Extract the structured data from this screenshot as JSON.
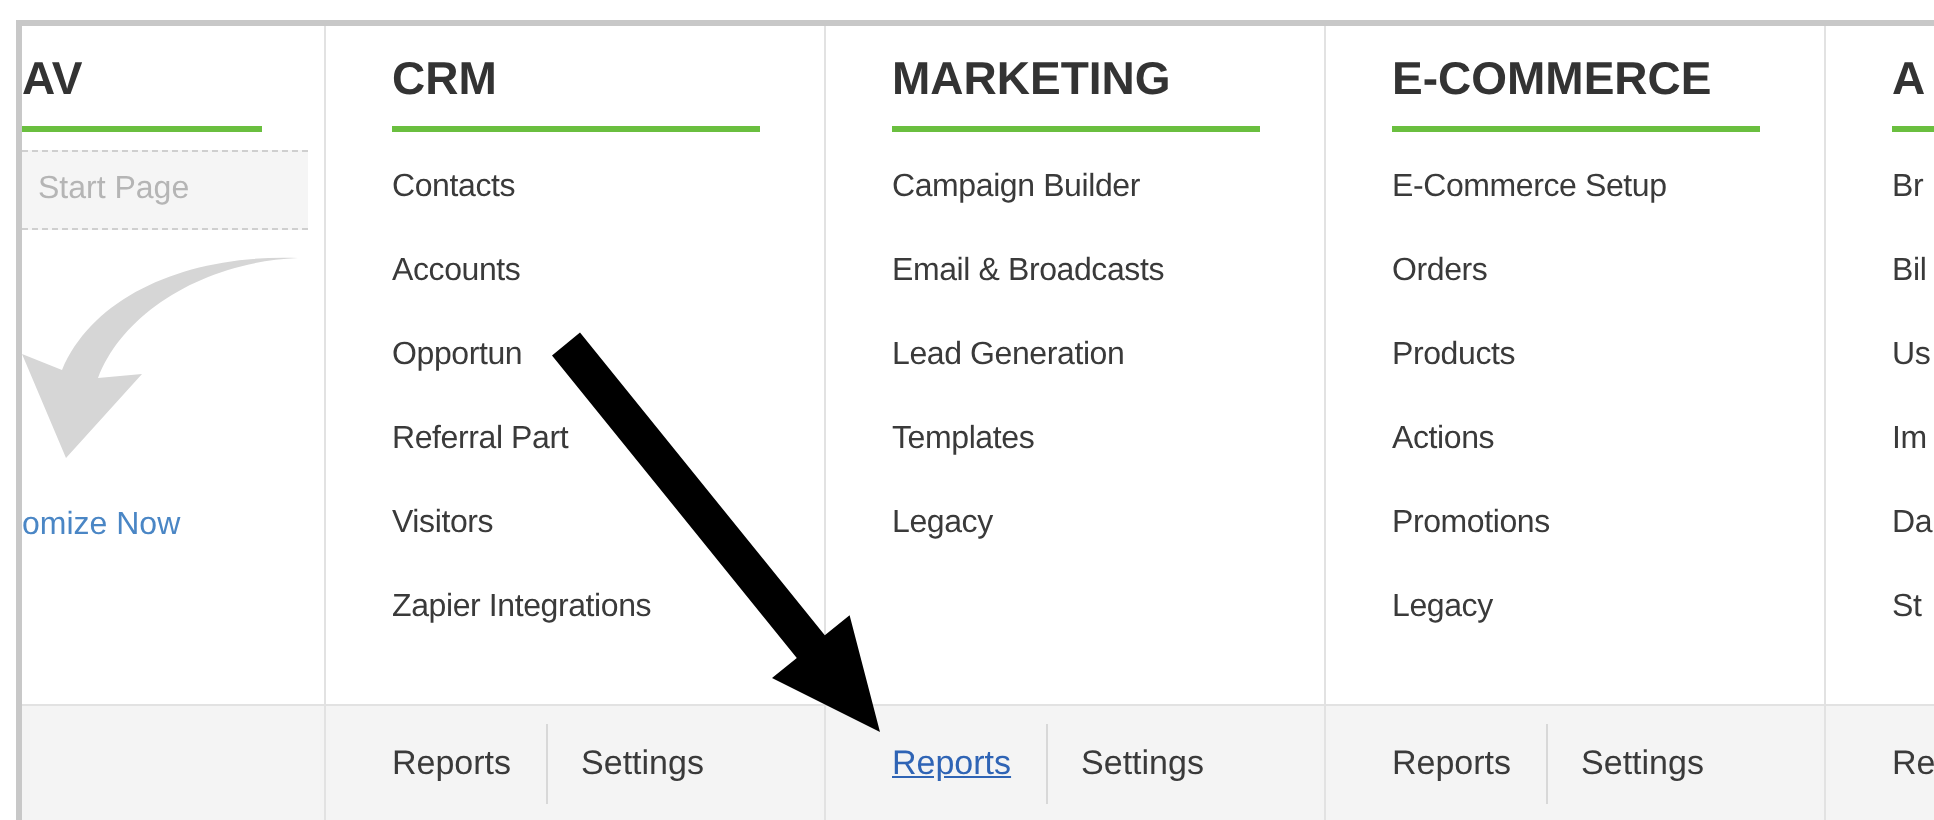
{
  "columns": [
    {
      "kind": "nav",
      "heading": "AV",
      "start_field": {
        "placeholder": "Start Page"
      },
      "link": "omize Now"
    },
    {
      "kind": "menu",
      "heading": "CRM",
      "items": [
        "Contacts",
        "Accounts",
        "Opportun",
        "Referral Part",
        "Visitors",
        "Zapier Integrations"
      ],
      "footer": [
        {
          "label": "Reports",
          "selected": false
        },
        {
          "label": "Settings",
          "selected": false
        }
      ]
    },
    {
      "kind": "menu",
      "heading": "MARKETING",
      "items": [
        "Campaign Builder",
        "Email & Broadcasts",
        "Lead Generation",
        "Templates",
        "Legacy"
      ],
      "footer": [
        {
          "label": "Reports",
          "selected": true
        },
        {
          "label": "Settings",
          "selected": false
        }
      ]
    },
    {
      "kind": "menu",
      "heading": "E-COMMERCE",
      "items": [
        "E-Commerce Setup",
        "Orders",
        "Products",
        "Actions",
        "Promotions",
        "Legacy"
      ],
      "footer": [
        {
          "label": "Reports",
          "selected": false
        },
        {
          "label": "Settings",
          "selected": false
        }
      ]
    },
    {
      "kind": "menu",
      "heading": "A",
      "items": [
        "Br",
        "Bil",
        "Us",
        "Im",
        "Da",
        "St"
      ],
      "footer": [
        {
          "label": "Re",
          "selected": false
        }
      ]
    }
  ]
}
